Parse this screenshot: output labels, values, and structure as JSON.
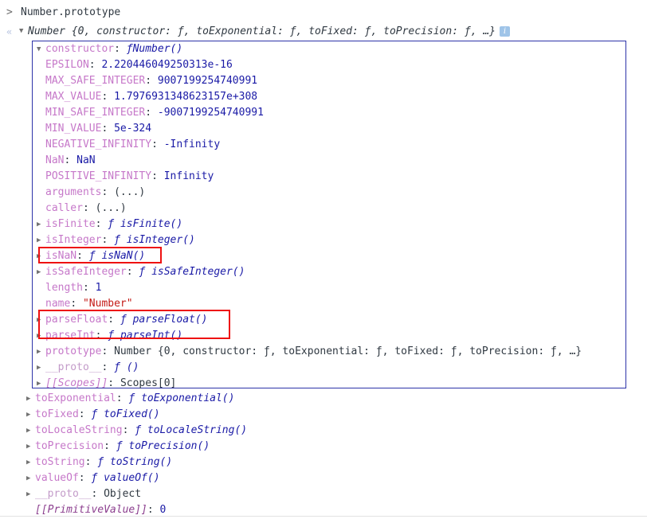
{
  "console": {
    "prompt_glyph": ">",
    "result_glyph": "«",
    "input_expression": "Number.prototype",
    "result_header": {
      "triangle": "▼",
      "text": "Number {0, constructor: ƒ, toExponential: ƒ, toFixed: ƒ, toPrecision: ƒ, …}",
      "info_icon_label": "i"
    }
  },
  "constructor_node": {
    "triangle": "▼",
    "label": "constructor",
    "colon": ":",
    "fn_glyph": "ƒ",
    "value": "Number()"
  },
  "constructor_props": [
    {
      "tri": "",
      "key": "EPSILON",
      "sep": ": ",
      "value": "2.220446049250313e-16",
      "vtype": "num"
    },
    {
      "tri": "",
      "key": "MAX_SAFE_INTEGER",
      "sep": ": ",
      "value": "9007199254740991",
      "vtype": "num"
    },
    {
      "tri": "",
      "key": "MAX_VALUE",
      "sep": ": ",
      "value": "1.7976931348623157e+308",
      "vtype": "num"
    },
    {
      "tri": "",
      "key": "MIN_SAFE_INTEGER",
      "sep": ": ",
      "value": "-9007199254740991",
      "vtype": "num"
    },
    {
      "tri": "",
      "key": "MIN_VALUE",
      "sep": ": ",
      "value": "5e-324",
      "vtype": "num"
    },
    {
      "tri": "",
      "key": "NEGATIVE_INFINITY",
      "sep": ": ",
      "value": "-Infinity",
      "vtype": "num"
    },
    {
      "tri": "",
      "key": "NaN",
      "sep": ": ",
      "value": "NaN",
      "vtype": "num"
    },
    {
      "tri": "",
      "key": "POSITIVE_INFINITY",
      "sep": ": ",
      "value": "Infinity",
      "vtype": "num"
    },
    {
      "tri": "",
      "key": "arguments",
      "sep": ": ",
      "value": "(...)",
      "vtype": "plain"
    },
    {
      "tri": "",
      "key": "caller",
      "sep": ": ",
      "value": "(...)",
      "vtype": "plain"
    },
    {
      "tri": "▶",
      "key": "isFinite",
      "sep": ": ",
      "value": "isFinite()",
      "vtype": "fn"
    },
    {
      "tri": "▶",
      "key": "isInteger",
      "sep": ": ",
      "value": "isInteger()",
      "vtype": "fn"
    },
    {
      "tri": "▶",
      "key": "isNaN",
      "sep": ": ",
      "value": "isNaN()",
      "vtype": "fn",
      "highlight": true
    },
    {
      "tri": "▶",
      "key": "isSafeInteger",
      "sep": ": ",
      "value": "isSafeInteger()",
      "vtype": "fn"
    },
    {
      "tri": "",
      "key": "length",
      "sep": ": ",
      "value": "1",
      "vtype": "num"
    },
    {
      "tri": "",
      "key": "name",
      "sep": ": ",
      "value": "\"Number\"",
      "vtype": "str"
    },
    {
      "tri": "▶",
      "key": "parseFloat",
      "sep": ": ",
      "value": "parseFloat()",
      "vtype": "fn",
      "highlight": true
    },
    {
      "tri": "▶",
      "key": "parseInt",
      "sep": ": ",
      "value": "parseInt()",
      "vtype": "fn",
      "highlight": true
    },
    {
      "tri": "▶",
      "key": "prototype",
      "sep": ": ",
      "value": "Number {0, constructor: ƒ, toExponential: ƒ, toFixed: ƒ, toPrecision: ƒ, …}",
      "vtype": "obj"
    },
    {
      "tri": "▶",
      "key": "__proto__",
      "sep": ": ",
      "value": "()",
      "vtype": "fn-bare"
    },
    {
      "tri": "▶",
      "key": "[[Scopes]]",
      "sep": ": ",
      "value": "Scopes[0]",
      "vtype": "internal"
    }
  ],
  "tail_props": [
    {
      "tri": "▶",
      "key": "toExponential",
      "sep": ": ",
      "value": "toExponential()",
      "vtype": "fn"
    },
    {
      "tri": "▶",
      "key": "toFixed",
      "sep": ": ",
      "value": "toFixed()",
      "vtype": "fn"
    },
    {
      "tri": "▶",
      "key": "toLocaleString",
      "sep": ": ",
      "value": "toLocaleString()",
      "vtype": "fn"
    },
    {
      "tri": "▶",
      "key": "toPrecision",
      "sep": ": ",
      "value": "toPrecision()",
      "vtype": "fn"
    },
    {
      "tri": "▶",
      "key": "toString",
      "sep": ": ",
      "value": "toString()",
      "vtype": "fn"
    },
    {
      "tri": "▶",
      "key": "valueOf",
      "sep": ": ",
      "value": "valueOf()",
      "vtype": "fn"
    },
    {
      "tri": "▶",
      "key": "__proto__",
      "sep": ": ",
      "value": "Object",
      "vtype": "plain"
    },
    {
      "tri": "",
      "key": "[[PrimitiveValue]]",
      "sep": ": ",
      "value": "0",
      "vtype": "num",
      "key_internal": true
    }
  ],
  "annotations": {
    "box_color": "#ee1111",
    "highlight_isnan_label": "isNaN",
    "highlight_parse_label": "parseFloat / parseInt"
  },
  "theme": {
    "object_border": "#2d33a8",
    "key_color": "#c678c9",
    "number_color": "#1a1aa6",
    "string_color": "#c41a16",
    "text_color": "#303942"
  }
}
